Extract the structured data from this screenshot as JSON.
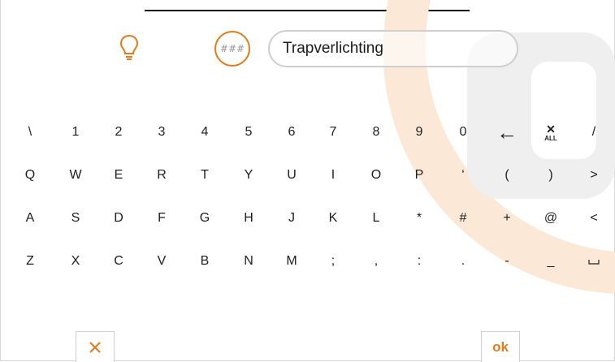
{
  "header": {
    "code_label": "###",
    "name_value": "Trapverlichting"
  },
  "keyboard": {
    "rows": [
      [
        "\\",
        "1",
        "2",
        "3",
        "4",
        "5",
        "6",
        "7",
        "8",
        "9",
        "0",
        "←",
        "CLEAR_ALL",
        "/"
      ],
      [
        "Q",
        "W",
        "E",
        "R",
        "T",
        "Y",
        "U",
        "I",
        "O",
        "P",
        "‘",
        "(",
        ")",
        ">"
      ],
      [
        "A",
        "S",
        "D",
        "F",
        "G",
        "H",
        "J",
        "K",
        "L",
        "*",
        "#",
        "+",
        "@",
        "<"
      ],
      [
        "Z",
        "X",
        "C",
        "V",
        "B",
        "N",
        "M",
        ";",
        ",",
        ":",
        ".",
        "-",
        "_",
        "␣"
      ]
    ],
    "clear_all_label": "ALL"
  },
  "footer": {
    "ok_label": "ok"
  },
  "colors": {
    "accent": "#e07b1a",
    "watermark": "#fbe8d6",
    "watermark_grey": "#efefef"
  },
  "icons": {
    "bulb": "lightbulb-icon",
    "backspace": "backspace-arrow-icon",
    "clear_all": "clear-all-icon",
    "cancel": "close-icon",
    "space": "space-icon"
  }
}
